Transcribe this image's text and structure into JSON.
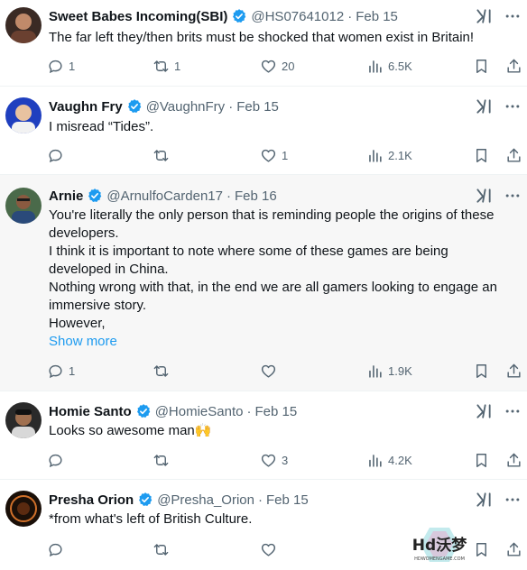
{
  "tweets": [
    {
      "name": "Sweet Babes Incoming(SBI)",
      "handle": "@HS07641012",
      "date": "Feb 15",
      "lines": [
        "The far left they/then brits must be shocked that  women exist in Britain!"
      ],
      "show_more": "",
      "replies": "1",
      "reposts": "1",
      "likes": "20",
      "views": "6.5K",
      "avatar_color": "#3a2a24"
    },
    {
      "name": "Vaughn Fry",
      "handle": "@VaughnFry",
      "date": "Feb 15",
      "lines": [
        "I misread “Tides”."
      ],
      "show_more": "",
      "replies": "",
      "reposts": "",
      "likes": "1",
      "views": "2.1K",
      "avatar_color": "#1f3fbf"
    },
    {
      "name": "Arnie",
      "handle": "@ArnulfoCarden17",
      "date": "Feb 16",
      "lines": [
        "You're literally the only person that is reminding people the origins of these",
        "developers.",
        "I think it is important to note where some of these games are being",
        "developed in China.",
        "Nothing wrong with that, in the end we are all gamers looking to engage an",
        "immersive story.",
        "However,"
      ],
      "show_more": "Show more",
      "replies": "1",
      "reposts": "",
      "likes": "",
      "views": "1.9K",
      "avatar_color": "#4a6a4a"
    },
    {
      "name": "Homie Santo",
      "handle": "@HomieSanto",
      "date": "Feb 15",
      "lines": [
        "Looks so awesome man🙌"
      ],
      "show_more": "",
      "replies": "",
      "reposts": "",
      "likes": "3",
      "views": "4.2K",
      "avatar_color": "#2a2a2a"
    },
    {
      "name": "Presha Orion",
      "handle": "@Presha_Orion",
      "date": "Feb 15",
      "lines": [
        "*from what's left of British Culture."
      ],
      "show_more": "",
      "replies": "",
      "reposts": "",
      "likes": "",
      "views": "",
      "avatar_color": "#1a0f08"
    }
  ],
  "watermark": {
    "main": "Hd沃梦",
    "sub": "HDWOMENGAME.COM"
  },
  "colors": {
    "accent": "#1d9bf0",
    "muted": "#536471",
    "text": "#0f1419",
    "highlight_bg": "#f7f7f7"
  },
  "icons": [
    "verified-badge-icon",
    "grok-icon",
    "more-icon",
    "reply-icon",
    "repost-icon",
    "like-icon",
    "views-icon",
    "bookmark-icon",
    "share-icon"
  ]
}
